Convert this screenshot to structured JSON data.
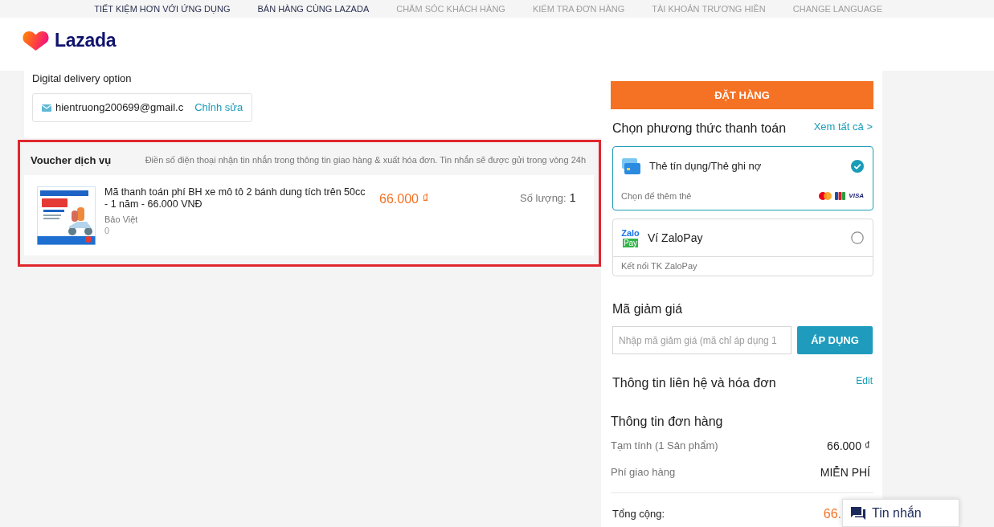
{
  "top_nav": [
    {
      "label": "TIẾT KIỆM HƠN VỚI ỨNG DỤNG",
      "emphasized": true
    },
    {
      "label": "BÁN HÀNG CÙNG LAZADA",
      "emphasized": true
    },
    {
      "label": "CHĂM SÓC KHÁCH HÀNG",
      "emphasized": false
    },
    {
      "label": "KIỂM TRA ĐƠN HÀNG",
      "emphasized": false
    },
    {
      "label": "TÀI KHOẢN TRƯƠNG HIỀN",
      "emphasized": false
    },
    {
      "label": "CHANGE LANGUAGE",
      "emphasized": false
    }
  ],
  "logo": {
    "text": "Lazada"
  },
  "delivery": {
    "title": "Digital delivery option",
    "email": "hientruong200699@gmail.c",
    "edit_link": "Chỉnh sửa"
  },
  "voucher_section": {
    "highlighted": true,
    "title": "Voucher dịch vụ",
    "note": "Điền số điện thoại nhận tin nhắn trong thông tin giao hàng & xuất hóa đơn. Tin nhắn sẽ được gửi trong vòng 24h",
    "items": [
      {
        "name": "Mã thanh toán phí BH xe mô tô 2 bánh dung tích trên 50cc - 1 năm - 66.000 VNĐ",
        "seller": "Bảo Việt",
        "extra_line": "0",
        "price": "66.000 ₫",
        "quantity_label": "Số lượng:",
        "quantity": "1"
      }
    ]
  },
  "order_button": "ĐẶT HÀNG",
  "payment": {
    "title": "Chọn phương thức thanh toán",
    "see_all": "Xem tất cả >",
    "methods": [
      {
        "kind": "card",
        "label": "Thẻ tín dụng/Thẻ ghi nợ",
        "hint": "Chọn để thêm thẻ",
        "brand_label": "VISA",
        "selected": true
      },
      {
        "kind": "wallet",
        "logo_top": "Zalo",
        "logo_bottom": "Pay",
        "label": "Ví ZaloPay",
        "hint": "Kết nối TK ZaloPay",
        "selected": false
      }
    ]
  },
  "voucher_code": {
    "title": "Mã giảm giá",
    "placeholder": "Nhập mã giảm giá (mã chỉ áp dụng 1",
    "button": "ÁP DỤNG"
  },
  "contact": {
    "title": "Thông tin liên hệ và hóa đơn",
    "edit_link": "Edit"
  },
  "order_summary": {
    "title": "Thông tin đơn hàng",
    "rows": [
      {
        "label": "Tạm tính (1 Sản phẩm)",
        "value": "66.000 ₫"
      },
      {
        "label": "Phí giao hàng",
        "value": "MIỄN PHÍ"
      }
    ],
    "total_label": "Tổng cộng:",
    "total_value": "66."
  },
  "chat": {
    "label": "Tin nhắn"
  }
}
